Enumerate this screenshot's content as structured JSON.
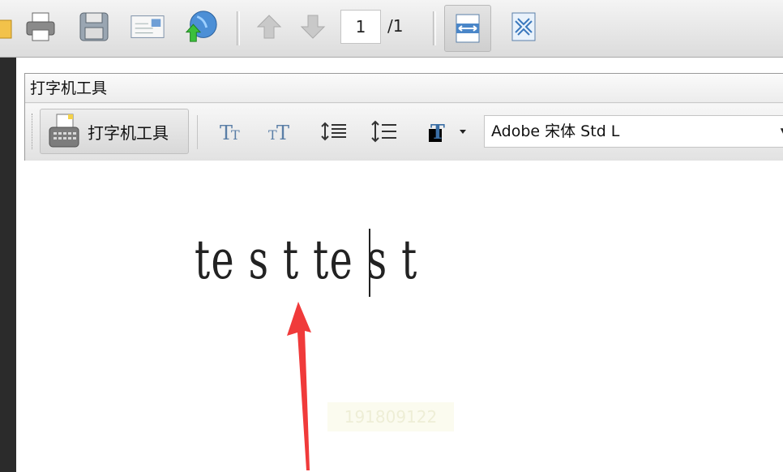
{
  "toolbar": {
    "buttons": [
      "open-icon",
      "print-icon",
      "save-icon",
      "email-icon",
      "upload-web-icon",
      "prev-page-icon",
      "next-page-icon",
      "fit-width-icon",
      "fit-page-icon"
    ],
    "page_current": "1",
    "page_total": "/1"
  },
  "typewriter_panel": {
    "title": "打字机工具",
    "tool_label": "打字机工具",
    "format_icons": [
      "decrease-text-size-icon",
      "increase-text-size-icon",
      "decrease-line-spacing-icon",
      "increase-line-spacing-icon",
      "text-color-icon"
    ],
    "font_name": "Adobe 宋体 Std L"
  },
  "document": {
    "typed_text": "te s t te s t",
    "watermark": "191809122"
  },
  "colors": {
    "arrow": "#f03a3a",
    "left_strip": "#2b2b2b"
  }
}
